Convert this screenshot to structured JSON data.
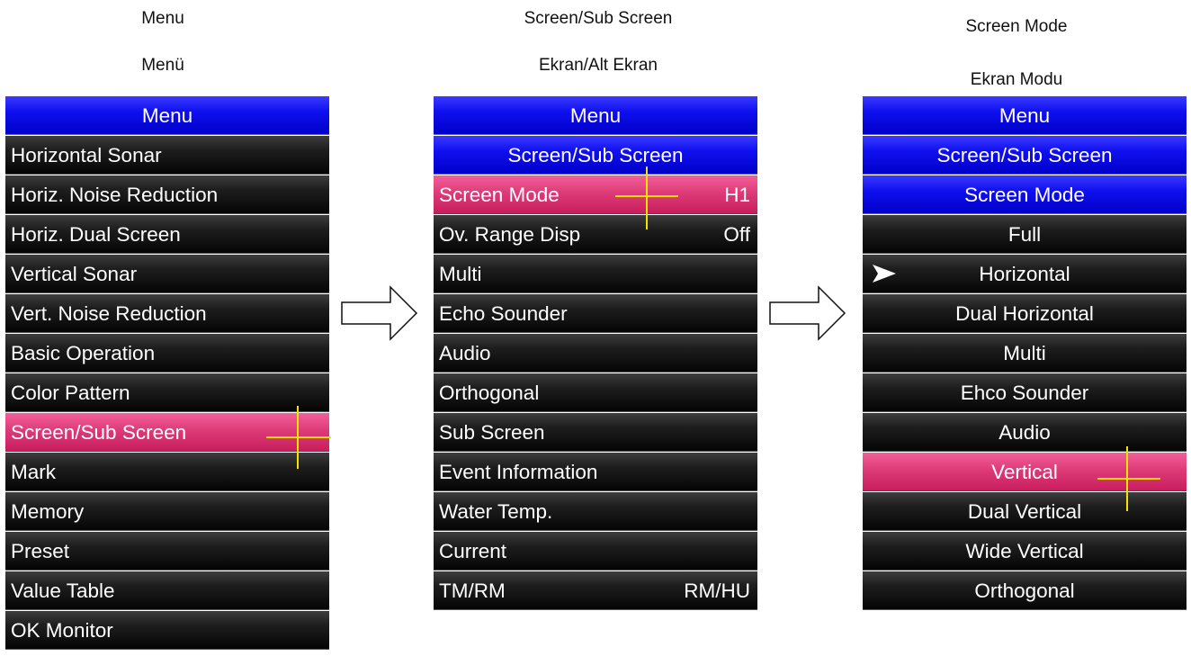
{
  "captions": {
    "col1": {
      "en": "Menu",
      "tr": "Menü"
    },
    "col2": {
      "en": "Screen/Sub Screen",
      "tr": "Ekran/Alt Ekran"
    },
    "col3": {
      "en": "Screen Mode",
      "tr": "Ekran Modu"
    }
  },
  "panel1": {
    "header": "Menu",
    "items": [
      "Horizontal Sonar",
      "Horiz. Noise Reduction",
      "Horiz. Dual Screen",
      "Vertical Sonar",
      "Vert. Noise Reduction",
      "Basic Operation",
      "Color Pattern",
      "Screen/Sub Screen",
      "Mark",
      "Memory",
      "Preset",
      "Value Table",
      "OK Monitor"
    ],
    "selected": "Screen/Sub Screen"
  },
  "panel2": {
    "header": "Menu",
    "subheader": "Screen/Sub Screen",
    "items": [
      {
        "label": "Screen Mode",
        "value": "H1"
      },
      {
        "label": "Ov. Range Disp",
        "value": "Off"
      },
      {
        "label": "Multi",
        "value": ""
      },
      {
        "label": "Echo Sounder",
        "value": ""
      },
      {
        "label": "Audio",
        "value": ""
      },
      {
        "label": "Orthogonal",
        "value": ""
      },
      {
        "label": "Sub Screen",
        "value": ""
      },
      {
        "label": "Event Information",
        "value": ""
      },
      {
        "label": "Water Temp.",
        "value": ""
      },
      {
        "label": "Current",
        "value": ""
      },
      {
        "label": "TM/RM",
        "value": "RM/HU"
      }
    ],
    "selected": "Screen Mode"
  },
  "panel3": {
    "header": "Menu",
    "subheader": "Screen/Sub Screen",
    "subheader2": "Screen Mode",
    "items": [
      "Full",
      "Horizontal",
      "Dual Horizontal",
      "Multi",
      "Ehco Sounder",
      "Audio",
      "Vertical",
      "Dual Vertical",
      "Wide Vertical",
      "Orthogonal"
    ],
    "current": "Horizontal",
    "selected": "Vertical"
  },
  "icons": {
    "next_arrow": "right-arrow-outline-icon",
    "current_pointer": "pointer-arrow-icon",
    "cursor": "crosshair-cursor-icon"
  },
  "colors": {
    "header_blue": "#0000e0",
    "selected_pink": "#de3b78",
    "row_black": "#0a0a0a",
    "cursor_yellow": "#f2e300"
  }
}
